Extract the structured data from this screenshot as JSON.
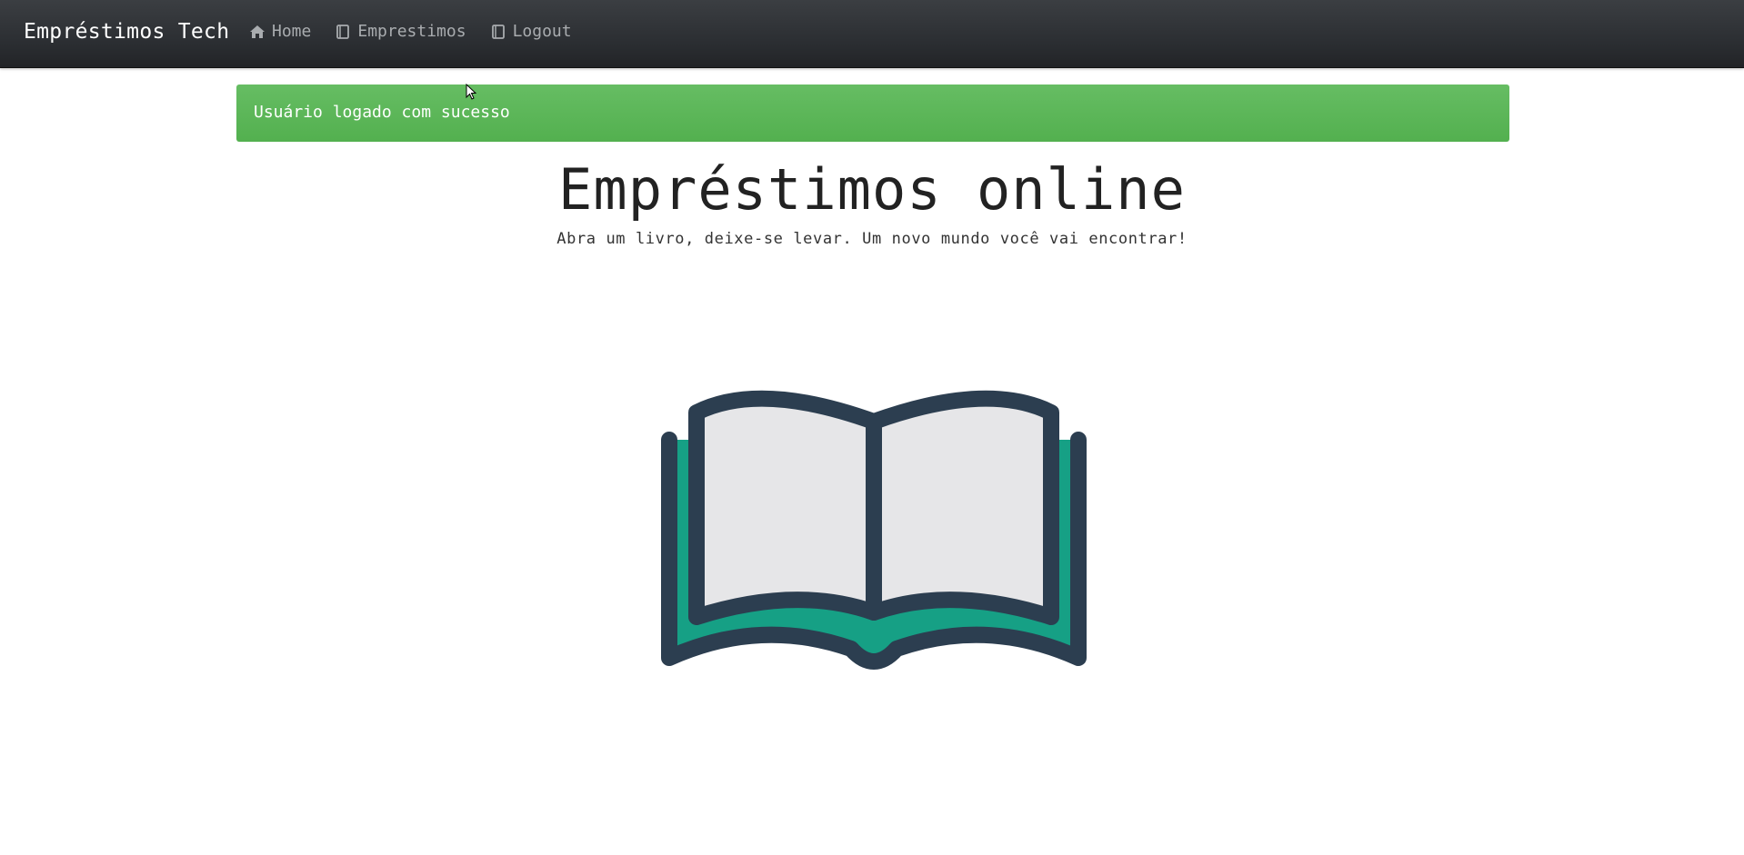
{
  "navbar": {
    "brand": "Empréstimos Tech",
    "links": [
      {
        "label": "Home",
        "icon": "home-icon"
      },
      {
        "label": "Emprestimos",
        "icon": "book-icon"
      },
      {
        "label": "Logout",
        "icon": "book-icon"
      }
    ]
  },
  "alert": {
    "message": "Usuário logado com sucesso",
    "color": "#5cb85c"
  },
  "hero": {
    "title": "Empréstimos online",
    "subtitle": "Abra um livro, deixe-se levar. Um novo mundo você vai encontrar!"
  },
  "illustration": {
    "icon": "open-book-icon",
    "colors": {
      "outline": "#2c3e50",
      "pages": "#e6e6e8",
      "cover": "#16a085"
    }
  }
}
